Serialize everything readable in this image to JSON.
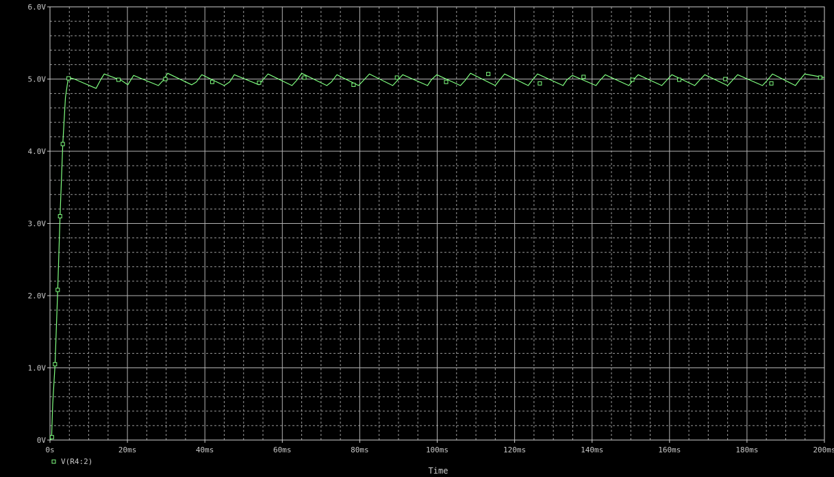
{
  "chart_data": {
    "type": "line",
    "title": "",
    "xlabel": "Time",
    "ylabel": "",
    "xlim": [
      0,
      200
    ],
    "ylim": [
      0,
      6
    ],
    "x_unit": "ms",
    "y_unit": "V",
    "grid": true,
    "legend_position": "bottom-left",
    "x_ticks": [
      {
        "value": 0,
        "label": "0s"
      },
      {
        "value": 20,
        "label": "20ms"
      },
      {
        "value": 40,
        "label": "40ms"
      },
      {
        "value": 60,
        "label": "60ms"
      },
      {
        "value": 80,
        "label": "80ms"
      },
      {
        "value": 100,
        "label": "100ms"
      },
      {
        "value": 120,
        "label": "120ms"
      },
      {
        "value": 140,
        "label": "140ms"
      },
      {
        "value": 160,
        "label": "160ms"
      },
      {
        "value": 180,
        "label": "180ms"
      },
      {
        "value": 200,
        "label": "200ms"
      }
    ],
    "y_ticks": [
      {
        "value": 0,
        "label": "0V"
      },
      {
        "value": 1,
        "label": "1.0V"
      },
      {
        "value": 2,
        "label": "2.0V"
      },
      {
        "value": 3,
        "label": "3.0V"
      },
      {
        "value": 4,
        "label": "4.0V"
      },
      {
        "value": 5,
        "label": "5.0V"
      },
      {
        "value": 6,
        "label": "6.0V"
      }
    ],
    "series": [
      {
        "name": "V(R4:2)",
        "color": "#80ff80",
        "marker": "square",
        "x": [
          0.0,
          0.4,
          0.7,
          1.3,
          2.0,
          2.6,
          3.3,
          4.0,
          4.6,
          5.0,
          6.3,
          11.9,
          13.2,
          14.0,
          18.5,
          20.1,
          21.6,
          28.0,
          29.2,
          30.4,
          36.6,
          37.8,
          39.2,
          45.0,
          46.4,
          47.6,
          54.0,
          55.0,
          56.3,
          62.5,
          63.7,
          65.0,
          71.5,
          72.7,
          74.1,
          79.7,
          81.1,
          82.5,
          88.5,
          89.7,
          91.1,
          97.5,
          98.5,
          99.9,
          106.0,
          107.2,
          108.6,
          115.0,
          116.0,
          117.4,
          123.5,
          124.5,
          125.9,
          132.5,
          133.5,
          134.9,
          141.0,
          142.0,
          143.4,
          149.5,
          150.5,
          151.9,
          158.0,
          159.2,
          160.6,
          166.5,
          167.7,
          169.1,
          175.0,
          176.2,
          177.6,
          184.0,
          185.2,
          186.6,
          192.5,
          193.5,
          194.9,
          200.0
        ],
        "y": [
          0.0,
          0.02,
          0.5,
          1.05,
          2.08,
          3.1,
          4.1,
          4.75,
          4.97,
          5.02,
          5.0,
          4.87,
          5.0,
          5.07,
          4.98,
          4.92,
          5.05,
          4.91,
          4.98,
          5.08,
          4.92,
          4.96,
          5.06,
          4.91,
          4.96,
          5.06,
          4.92,
          4.99,
          5.07,
          4.91,
          4.98,
          5.08,
          4.91,
          4.96,
          5.06,
          4.91,
          4.99,
          5.07,
          4.91,
          4.98,
          5.06,
          4.91,
          4.99,
          5.06,
          4.91,
          4.98,
          5.08,
          4.91,
          4.98,
          5.07,
          4.91,
          4.98,
          5.07,
          4.91,
          4.99,
          5.05,
          4.91,
          4.98,
          5.06,
          4.91,
          4.98,
          5.06,
          4.91,
          4.98,
          5.06,
          4.91,
          4.98,
          5.06,
          4.91,
          4.98,
          5.06,
          4.91,
          4.98,
          5.07,
          4.91,
          4.98,
          5.07,
          5.02
        ],
        "markers": [
          [
            0.5,
            0.04
          ],
          [
            1.3,
            1.05
          ],
          [
            2.0,
            2.08
          ],
          [
            2.6,
            3.1
          ],
          [
            3.3,
            4.1
          ],
          [
            4.8,
            5.01
          ],
          [
            17.7,
            4.99
          ],
          [
            29.8,
            5.0
          ],
          [
            41.9,
            4.96
          ],
          [
            54.0,
            4.95
          ],
          [
            65.7,
            5.02
          ],
          [
            78.4,
            4.92
          ],
          [
            89.6,
            5.02
          ],
          [
            102.3,
            4.96
          ],
          [
            113.2,
            5.07
          ],
          [
            126.5,
            4.94
          ],
          [
            137.8,
            5.03
          ],
          [
            150.4,
            4.99
          ],
          [
            162.5,
            4.99
          ],
          [
            174.4,
            5.0
          ],
          [
            186.3,
            4.94
          ],
          [
            198.9,
            5.02
          ]
        ]
      }
    ]
  }
}
